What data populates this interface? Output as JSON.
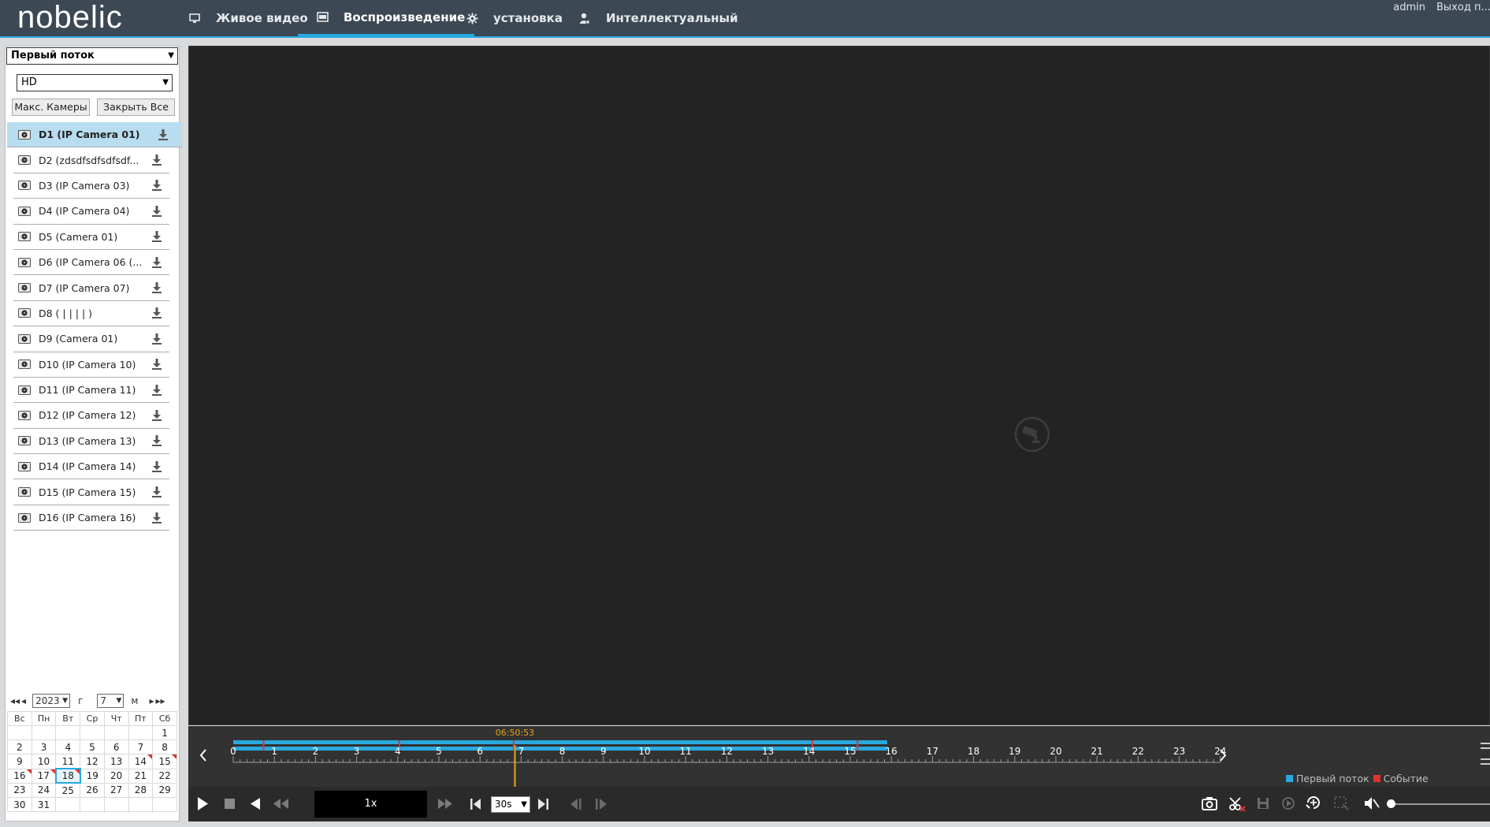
{
  "header": {
    "logo": "nobelic",
    "nav": [
      {
        "label": "Живое видео",
        "icon": "monitor-icon",
        "active": false
      },
      {
        "label": "Воспроизведение",
        "icon": "playback-icon",
        "active": true
      },
      {
        "label": "установка",
        "icon": "gear-icon",
        "active": false
      },
      {
        "label": "Интеллектуальный",
        "icon": "person-icon",
        "active": false
      }
    ],
    "user": "admin",
    "logout": "Выход п..."
  },
  "left_panel": {
    "stream_select": "Первый поток",
    "quality_select": "HD",
    "max_cameras_button": "Макс. Камеры",
    "close_all_button": "Закрыть Все",
    "cameras": [
      {
        "label": "D1 (IP Camera 01)",
        "selected": true
      },
      {
        "label": "D2 (zdsdfsdfsdfsdf..."
      },
      {
        "label": "D3 (IP Camera 03)"
      },
      {
        "label": "D4 (IP Camera 04)"
      },
      {
        "label": "D5 (Camera 01)"
      },
      {
        "label": "D6 (IP Camera 06 (..."
      },
      {
        "label": "D7 (IP Camera 07)"
      },
      {
        "label": "D8 ( | | | | )"
      },
      {
        "label": "D9 (Camera 01)"
      },
      {
        "label": "D10 (IP Camera 10)"
      },
      {
        "label": "D11 (IP Camera 11)"
      },
      {
        "label": "D12 (IP Camera 12)"
      },
      {
        "label": "D13 (IP Camera 13)"
      },
      {
        "label": "D14 (IP Camera 14)"
      },
      {
        "label": "D15 (IP Camera 15)"
      },
      {
        "label": "D16 (IP Camera 16)"
      }
    ]
  },
  "calendar": {
    "year": "2023",
    "year_suffix": "г",
    "month": "7",
    "month_suffix": "м",
    "weekdays": [
      "Вс",
      "Пн",
      "Вт",
      "Ср",
      "Чт",
      "Пт",
      "Сб"
    ],
    "weeks": [
      [
        "",
        "",
        "",
        "",
        "",
        "",
        "1"
      ],
      [
        "2",
        "3",
        "4",
        "5",
        "6",
        "7",
        "8"
      ],
      [
        "9",
        "10",
        "11",
        "12",
        "13",
        "14",
        "15"
      ],
      [
        "16",
        "17",
        "18",
        "19",
        "20",
        "21",
        "22"
      ],
      [
        "23",
        "24",
        "25",
        "26",
        "27",
        "28",
        "29"
      ],
      [
        "30",
        "31",
        "",
        "",
        "",
        "",
        ""
      ]
    ],
    "today": "18",
    "record_days": [
      "14",
      "15",
      "16",
      "17",
      "18"
    ]
  },
  "timeline": {
    "current_time": "06:50:53",
    "current_hour": 6.8481,
    "hours": [
      "0",
      "1",
      "2",
      "3",
      "4",
      "5",
      "6",
      "7",
      "8",
      "9",
      "10",
      "11",
      "12",
      "13",
      "14",
      "15",
      "16",
      "17",
      "18",
      "19",
      "20",
      "21",
      "22",
      "23",
      "24"
    ],
    "recording_range": [
      0,
      15.9
    ],
    "event_marks": [
      0.72,
      4.02,
      6.8,
      14.06,
      15.16
    ],
    "legend_main": "Первый поток",
    "legend_event": "Событие",
    "colors": {
      "recording": "#29a8e0",
      "event": "#e0332f",
      "cursor": "#e8a317"
    }
  },
  "controls": {
    "speed": "1x",
    "step": "30s"
  }
}
